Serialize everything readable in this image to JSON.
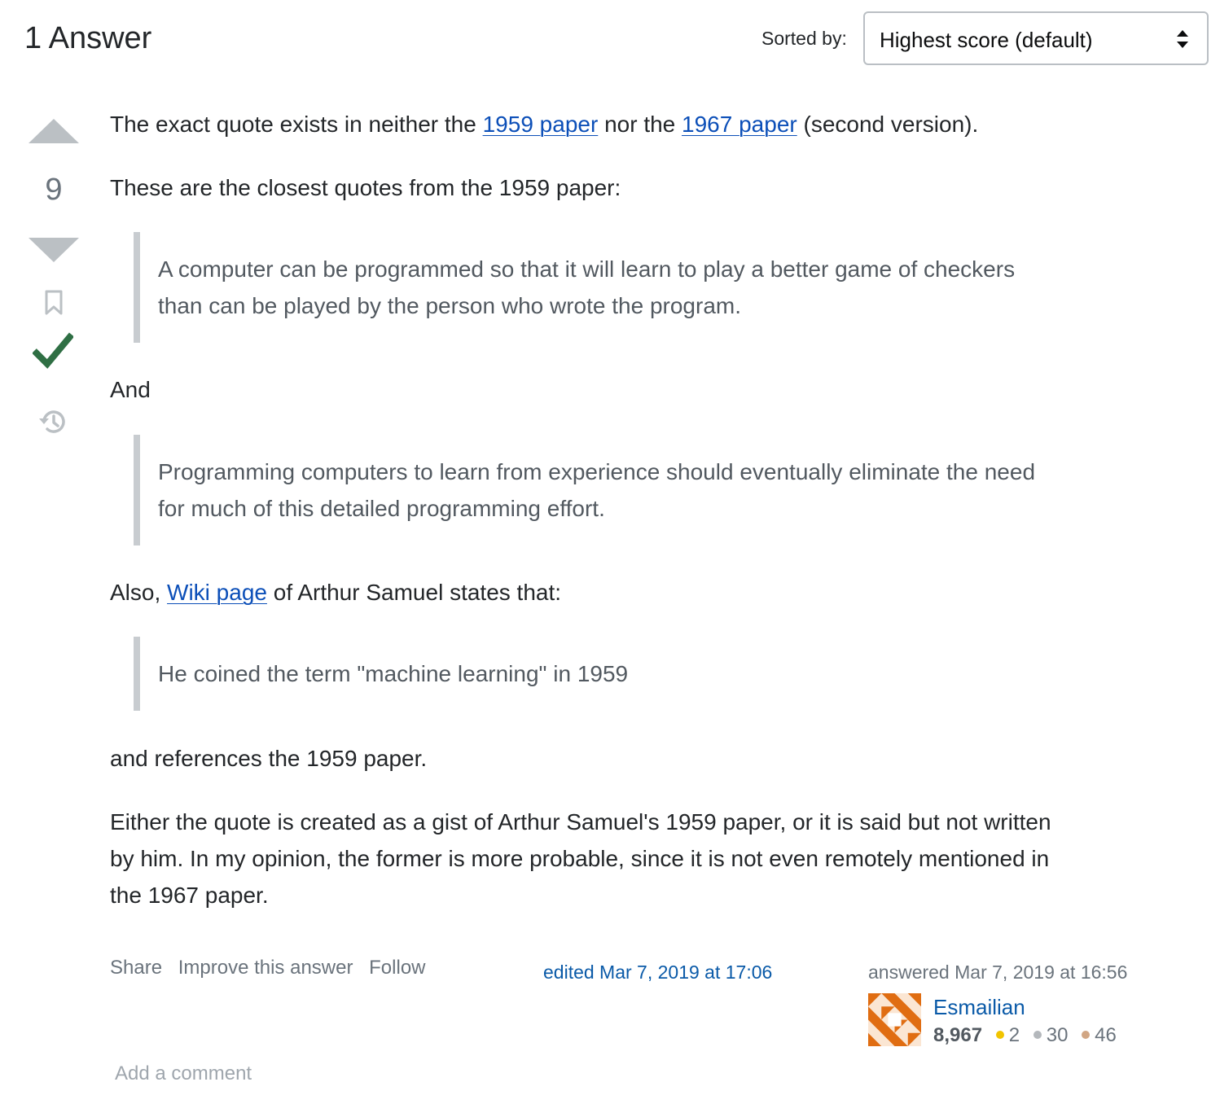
{
  "header": {
    "answer_count": "1 Answer",
    "sort_label": "Sorted by:",
    "sort_value": "Highest score (default)"
  },
  "votes": {
    "score": "9"
  },
  "post": {
    "p1": {
      "before": "The exact quote exists in neither the ",
      "link1": "1959 paper",
      "middle": " nor the ",
      "link2": "1967 paper",
      "after": " (second version)."
    },
    "p2": "These are the closest quotes from the 1959 paper:",
    "quote1": [
      "A computer can be programmed so that it will learn to play a better game of checkers",
      "than can be played by the person who wrote the program."
    ],
    "p3": "And",
    "quote2": [
      "Programming computers to learn from experience should eventually eliminate the need",
      "for much of this detailed programming effort."
    ],
    "p4": {
      "before": "Also, ",
      "link": "Wiki page",
      "after": " of Arthur Samuel states that:"
    },
    "quote3": [
      "He coined the term \"machine learning\" in 1959"
    ],
    "p5": "and references the 1959 paper.",
    "p6": [
      "Either the quote is created as a gist of Arthur Samuel's 1959 paper, or it is said but not written",
      "by him. In my opinion, the former is more probable, since it is not even remotely mentioned in",
      "the 1967 paper."
    ]
  },
  "menu": {
    "share": "Share",
    "improve": "Improve this answer",
    "follow": "Follow"
  },
  "edited": "edited Mar 7, 2019 at 17:06",
  "answered": "answered Mar 7, 2019 at 16:56",
  "user": {
    "name": "Esmailian",
    "reputation": "8,967",
    "gold": "2",
    "silver": "30",
    "bronze": "46"
  },
  "add_comment": "Add a comment",
  "colors": {
    "link": "#0c4fb8",
    "accepted": "#2f6f44",
    "gold": "#f1c400",
    "silver": "#b4b8bc",
    "bronze": "#d1a684",
    "avatar_primary": "#e06d12"
  }
}
